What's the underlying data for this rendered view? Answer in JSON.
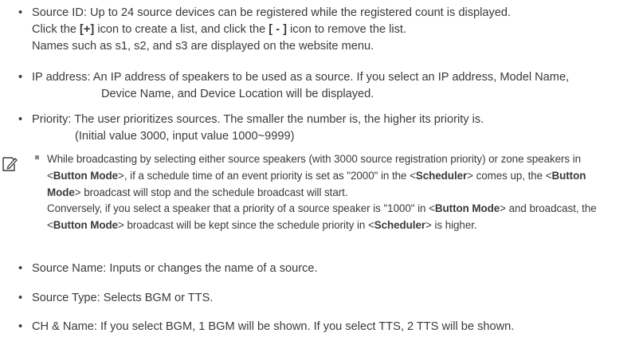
{
  "bullet_symbol": "•",
  "source_id": {
    "line1": "Source ID: Up to 24 source devices can be registered while the registered count is displayed.",
    "line2_pre": "Click the ",
    "line2_plus": "[+]",
    "line2_mid": " icon to create a list, and click the ",
    "line2_minus": "[ - ]",
    "line2_post": " icon to remove the list.",
    "line3": "Names such as s1, s2, and s3 are displayed on the website menu."
  },
  "ip_address": {
    "line1": "IP address: An IP address of speakers to be used as a source. If you select an IP address, Model Name,",
    "line2": "Device Name, and Device Location will be displayed."
  },
  "priority": {
    "line1": "Priority: The user prioritizes sources. The smaller the number is, the higher its priority is.",
    "line2": "(Initial value 3000, input value 1000~9999)"
  },
  "note": {
    "l1": "While broadcasting by selecting either source speakers (with 3000 source registration priority) or zone speakers in",
    "l2_a": "<",
    "l2_b": "Button Mode",
    "l2_c": ">, if a schedule time of an event priority is set as \"2000\" in the <",
    "l2_d": "Scheduler",
    "l2_e": "> comes up, the <",
    "l2_f": "Button",
    "l3_a": "Mode",
    "l3_b": "> broadcast will stop and the schedule broadcast will start.",
    "l4_a": "Conversely, if you select a speaker that a priority of a source speaker is \"1000\" in <",
    "l4_b": "Button Mode",
    "l4_c": "> and broadcast, the",
    "l5_a": "<",
    "l5_b": "Button Mode",
    "l5_c": "> broadcast will be kept since the schedule priority in <",
    "l5_d": "Scheduler",
    "l5_e": "> is higher."
  },
  "source_name": "Source Name: Inputs or changes the name of a source.",
  "source_type": "Source Type: Selects BGM or TTS.",
  "ch_name": "CH & Name: If you select BGM, 1 BGM will be shown. If you select TTS, 2 TTS will be shown."
}
